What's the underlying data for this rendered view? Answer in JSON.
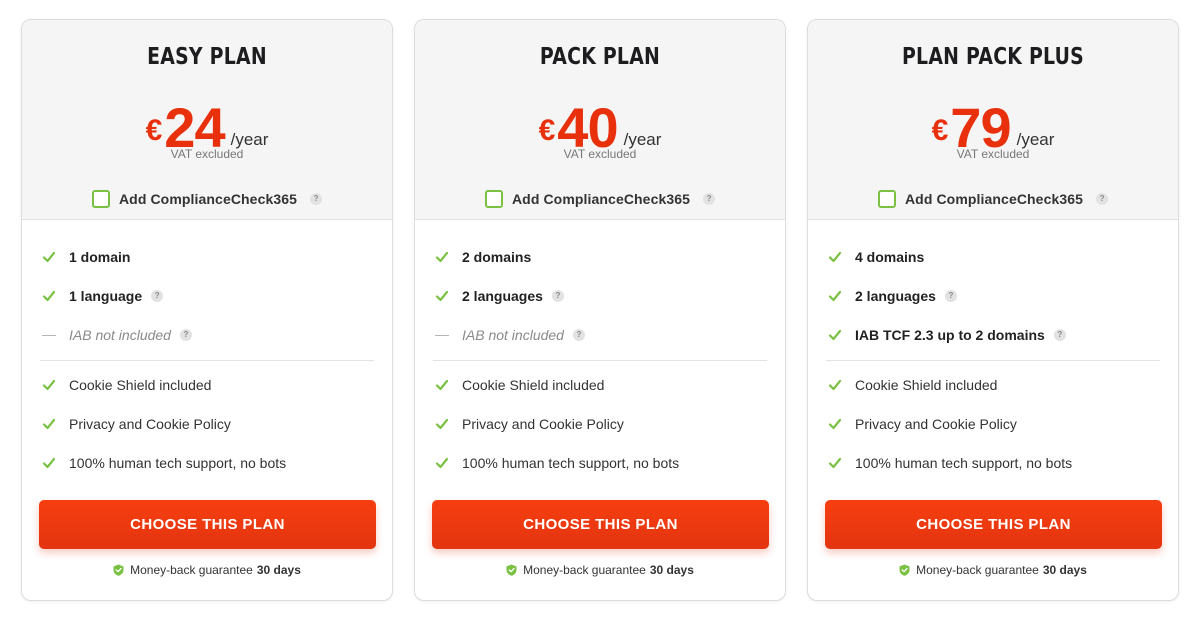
{
  "accent_color": "#e8300c",
  "check_color": "#7ac143",
  "plans": [
    {
      "name": "EASY PLAN",
      "currency": "€",
      "price": "24",
      "period": "/year",
      "vat_note": "VAT excluded",
      "addon_label": "Add ComplianceCheck365",
      "help_glyph": "?",
      "features": [
        {
          "text": "1 domain",
          "icon": "check-icon",
          "style": "bold",
          "help": false
        },
        {
          "text": "1 language",
          "icon": "check-icon",
          "style": "bold",
          "help": true
        },
        {
          "text": "IAB not included",
          "icon": "dash-icon",
          "style": "muted",
          "help": true
        },
        {
          "text": "Cookie Shield included",
          "icon": "check-icon",
          "style": "light",
          "help": false
        },
        {
          "text": "Privacy and Cookie Policy",
          "icon": "check-icon",
          "style": "light",
          "help": false
        },
        {
          "text": "100% human tech support, no bots",
          "icon": "check-icon",
          "style": "light",
          "help": false
        }
      ],
      "cta_label": "CHOOSE THIS PLAN",
      "guarantee_text": "Money-back guarantee",
      "guarantee_days": "30 days"
    },
    {
      "name": "PACK PLAN",
      "currency": "€",
      "price": "40",
      "period": "/year",
      "vat_note": "VAT excluded",
      "addon_label": "Add ComplianceCheck365",
      "help_glyph": "?",
      "features": [
        {
          "text": "2 domains",
          "icon": "check-icon",
          "style": "bold",
          "help": false
        },
        {
          "text": "2 languages",
          "icon": "check-icon",
          "style": "bold",
          "help": true
        },
        {
          "text": "IAB not included",
          "icon": "dash-icon",
          "style": "muted",
          "help": true
        },
        {
          "text": "Cookie Shield included",
          "icon": "check-icon",
          "style": "light",
          "help": false
        },
        {
          "text": "Privacy and Cookie Policy",
          "icon": "check-icon",
          "style": "light",
          "help": false
        },
        {
          "text": "100% human tech support, no bots",
          "icon": "check-icon",
          "style": "light",
          "help": false
        }
      ],
      "cta_label": "CHOOSE THIS PLAN",
      "guarantee_text": "Money-back guarantee",
      "guarantee_days": "30 days"
    },
    {
      "name": "PLAN PACK PLUS",
      "currency": "€",
      "price": "79",
      "period": "/year",
      "vat_note": "VAT excluded",
      "addon_label": "Add ComplianceCheck365",
      "help_glyph": "?",
      "features": [
        {
          "text": "4 domains",
          "icon": "check-icon",
          "style": "bold",
          "help": false
        },
        {
          "text": "2 languages",
          "icon": "check-icon",
          "style": "bold",
          "help": true
        },
        {
          "text": "IAB TCF 2.3 up to 2 domains",
          "icon": "check-icon",
          "style": "bold",
          "help": true
        },
        {
          "text": "Cookie Shield included",
          "icon": "check-icon",
          "style": "light",
          "help": false
        },
        {
          "text": "Privacy and Cookie Policy",
          "icon": "check-icon",
          "style": "light",
          "help": false
        },
        {
          "text": "100% human tech support, no bots",
          "icon": "check-icon",
          "style": "light",
          "help": false
        }
      ],
      "cta_label": "CHOOSE THIS PLAN",
      "guarantee_text": "Money-back guarantee",
      "guarantee_days": "30 days"
    }
  ]
}
